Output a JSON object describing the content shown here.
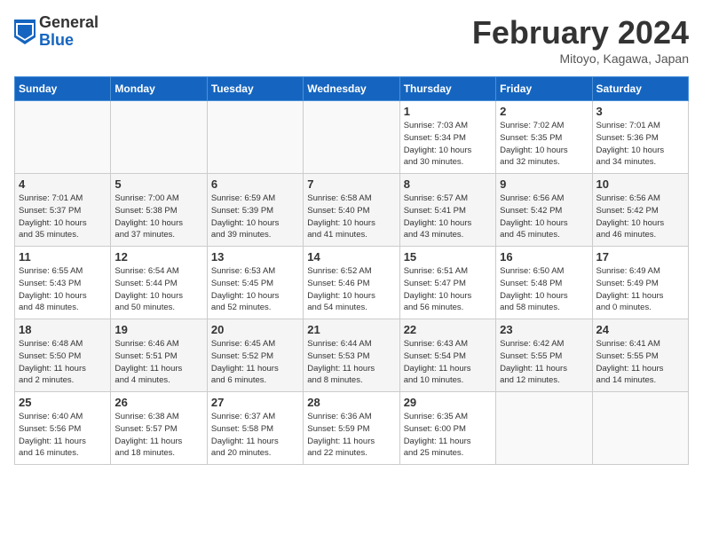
{
  "header": {
    "logo_general": "General",
    "logo_blue": "Blue",
    "month_title": "February 2024",
    "location": "Mitoyo, Kagawa, Japan"
  },
  "days_of_week": [
    "Sunday",
    "Monday",
    "Tuesday",
    "Wednesday",
    "Thursday",
    "Friday",
    "Saturday"
  ],
  "weeks": [
    [
      {
        "day": "",
        "info": ""
      },
      {
        "day": "",
        "info": ""
      },
      {
        "day": "",
        "info": ""
      },
      {
        "day": "",
        "info": ""
      },
      {
        "day": "1",
        "info": "Sunrise: 7:03 AM\nSunset: 5:34 PM\nDaylight: 10 hours\nand 30 minutes."
      },
      {
        "day": "2",
        "info": "Sunrise: 7:02 AM\nSunset: 5:35 PM\nDaylight: 10 hours\nand 32 minutes."
      },
      {
        "day": "3",
        "info": "Sunrise: 7:01 AM\nSunset: 5:36 PM\nDaylight: 10 hours\nand 34 minutes."
      }
    ],
    [
      {
        "day": "4",
        "info": "Sunrise: 7:01 AM\nSunset: 5:37 PM\nDaylight: 10 hours\nand 35 minutes."
      },
      {
        "day": "5",
        "info": "Sunrise: 7:00 AM\nSunset: 5:38 PM\nDaylight: 10 hours\nand 37 minutes."
      },
      {
        "day": "6",
        "info": "Sunrise: 6:59 AM\nSunset: 5:39 PM\nDaylight: 10 hours\nand 39 minutes."
      },
      {
        "day": "7",
        "info": "Sunrise: 6:58 AM\nSunset: 5:40 PM\nDaylight: 10 hours\nand 41 minutes."
      },
      {
        "day": "8",
        "info": "Sunrise: 6:57 AM\nSunset: 5:41 PM\nDaylight: 10 hours\nand 43 minutes."
      },
      {
        "day": "9",
        "info": "Sunrise: 6:56 AM\nSunset: 5:42 PM\nDaylight: 10 hours\nand 45 minutes."
      },
      {
        "day": "10",
        "info": "Sunrise: 6:56 AM\nSunset: 5:42 PM\nDaylight: 10 hours\nand 46 minutes."
      }
    ],
    [
      {
        "day": "11",
        "info": "Sunrise: 6:55 AM\nSunset: 5:43 PM\nDaylight: 10 hours\nand 48 minutes."
      },
      {
        "day": "12",
        "info": "Sunrise: 6:54 AM\nSunset: 5:44 PM\nDaylight: 10 hours\nand 50 minutes."
      },
      {
        "day": "13",
        "info": "Sunrise: 6:53 AM\nSunset: 5:45 PM\nDaylight: 10 hours\nand 52 minutes."
      },
      {
        "day": "14",
        "info": "Sunrise: 6:52 AM\nSunset: 5:46 PM\nDaylight: 10 hours\nand 54 minutes."
      },
      {
        "day": "15",
        "info": "Sunrise: 6:51 AM\nSunset: 5:47 PM\nDaylight: 10 hours\nand 56 minutes."
      },
      {
        "day": "16",
        "info": "Sunrise: 6:50 AM\nSunset: 5:48 PM\nDaylight: 10 hours\nand 58 minutes."
      },
      {
        "day": "17",
        "info": "Sunrise: 6:49 AM\nSunset: 5:49 PM\nDaylight: 11 hours\nand 0 minutes."
      }
    ],
    [
      {
        "day": "18",
        "info": "Sunrise: 6:48 AM\nSunset: 5:50 PM\nDaylight: 11 hours\nand 2 minutes."
      },
      {
        "day": "19",
        "info": "Sunrise: 6:46 AM\nSunset: 5:51 PM\nDaylight: 11 hours\nand 4 minutes."
      },
      {
        "day": "20",
        "info": "Sunrise: 6:45 AM\nSunset: 5:52 PM\nDaylight: 11 hours\nand 6 minutes."
      },
      {
        "day": "21",
        "info": "Sunrise: 6:44 AM\nSunset: 5:53 PM\nDaylight: 11 hours\nand 8 minutes."
      },
      {
        "day": "22",
        "info": "Sunrise: 6:43 AM\nSunset: 5:54 PM\nDaylight: 11 hours\nand 10 minutes."
      },
      {
        "day": "23",
        "info": "Sunrise: 6:42 AM\nSunset: 5:55 PM\nDaylight: 11 hours\nand 12 minutes."
      },
      {
        "day": "24",
        "info": "Sunrise: 6:41 AM\nSunset: 5:55 PM\nDaylight: 11 hours\nand 14 minutes."
      }
    ],
    [
      {
        "day": "25",
        "info": "Sunrise: 6:40 AM\nSunset: 5:56 PM\nDaylight: 11 hours\nand 16 minutes."
      },
      {
        "day": "26",
        "info": "Sunrise: 6:38 AM\nSunset: 5:57 PM\nDaylight: 11 hours\nand 18 minutes."
      },
      {
        "day": "27",
        "info": "Sunrise: 6:37 AM\nSunset: 5:58 PM\nDaylight: 11 hours\nand 20 minutes."
      },
      {
        "day": "28",
        "info": "Sunrise: 6:36 AM\nSunset: 5:59 PM\nDaylight: 11 hours\nand 22 minutes."
      },
      {
        "day": "29",
        "info": "Sunrise: 6:35 AM\nSunset: 6:00 PM\nDaylight: 11 hours\nand 25 minutes."
      },
      {
        "day": "",
        "info": ""
      },
      {
        "day": "",
        "info": ""
      }
    ]
  ]
}
